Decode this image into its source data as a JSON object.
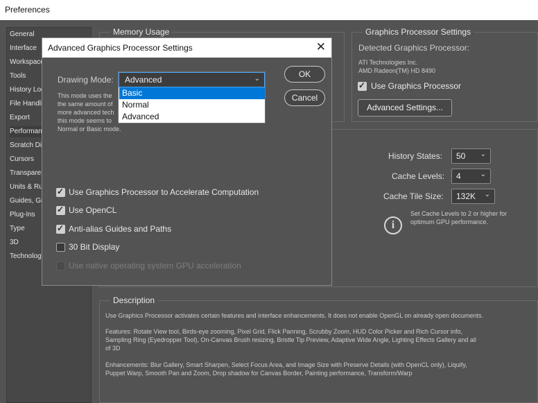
{
  "window": {
    "title": "Preferences"
  },
  "sidebar": {
    "items": [
      {
        "label": "General"
      },
      {
        "label": "Interface"
      },
      {
        "label": "Workspace"
      },
      {
        "label": "Tools"
      },
      {
        "label": "History Log"
      },
      {
        "label": "File Handling"
      },
      {
        "label": "Export"
      },
      {
        "label": "Performance",
        "selected": true
      },
      {
        "label": "Scratch Disks"
      },
      {
        "label": "Cursors"
      },
      {
        "label": "Transparency & Gamut"
      },
      {
        "label": "Units & Rulers"
      },
      {
        "label": "Guides, Grid & Slices"
      },
      {
        "label": "Plug-Ins"
      },
      {
        "label": "Type"
      },
      {
        "label": "3D"
      },
      {
        "label": "Technology Previews"
      }
    ]
  },
  "memory": {
    "legend": "Memory Usage"
  },
  "gpu_panel": {
    "legend": "Graphics Processor Settings",
    "detected_label": "Detected Graphics Processor:",
    "vendor": "ATI Technologies Inc.",
    "model": "AMD Radeon(TM) HD 8490",
    "use_gpu_label": "Use Graphics Processor",
    "use_gpu_checked": true,
    "advanced_button": "Advanced Settings..."
  },
  "history": {
    "states_label": "History States:",
    "states_value": "50",
    "levels_label": "Cache Levels:",
    "levels_value": "4",
    "tile_label": "Cache Tile Size:",
    "tile_value": "132K",
    "hint_line1": "Set Cache Levels to 2 or higher for",
    "hint_line2": "optimum GPU performance."
  },
  "description": {
    "legend": "Description",
    "para1": "Use Graphics Processor activates certain features and interface enhancements. It does not enable OpenGL on already open documents.",
    "para2_line1": "Features: Rotate View tool, Birds-eye zooming, Pixel Grid, Flick Panning, Scrubby Zoom, HUD Color Picker and Rich Cursor info,",
    "para2_line2": "Sampling Ring (Eyedropper Tool), On-Canvas Brush resizing, Bristle Tip Preview, Adaptive Wide Angle, Lighting Effects Gallery and all",
    "para2_line3": "of 3D",
    "para3_line1": "Enhancements: Blur Gallery, Smart Sharpen, Select Focus Area, and Image Size with Preserve Details (with OpenCL only), Liquify,",
    "para3_line2": "Puppet Warp, Smooth Pan and Zoom, Drop shadow for Canvas Border, Painting performance, Transform/Warp"
  },
  "dialog": {
    "title": "Advanced Graphics Processor Settings",
    "drawing_mode_label": "Drawing Mode:",
    "drawing_mode_value": "Advanced",
    "mode_options": [
      "Basic",
      "Normal",
      "Advanced"
    ],
    "highlighted_option": "Basic",
    "desc_line1": "This mode uses the",
    "desc_line2": "the same amount of",
    "desc_line3": "more advanced tech",
    "desc_line4": "this mode seems to",
    "desc_line5": "Normal or Basic mode.",
    "ok": "OK",
    "cancel": "Cancel",
    "options": [
      {
        "label": "Use Graphics Processor to Accelerate Computation",
        "checked": true,
        "enabled": true
      },
      {
        "label": "Use OpenCL",
        "checked": true,
        "enabled": true
      },
      {
        "label": "Anti-alias Guides and Paths",
        "checked": true,
        "enabled": true
      },
      {
        "label": "30 Bit Display",
        "checked": false,
        "enabled": true
      },
      {
        "label": "Use native operating system GPU acceleration",
        "checked": false,
        "enabled": false
      }
    ]
  }
}
